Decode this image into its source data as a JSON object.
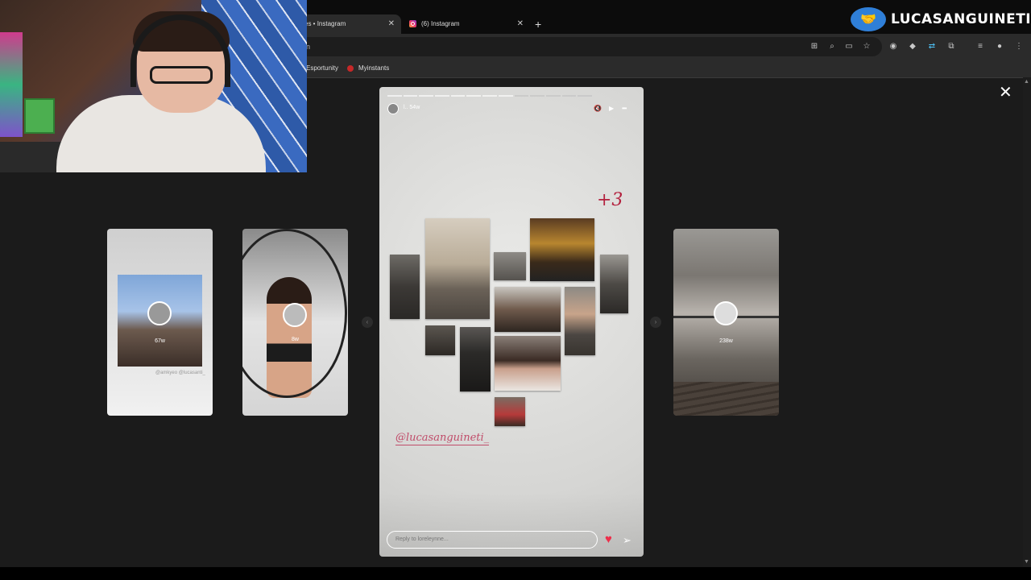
{
  "browser": {
    "tabs": [
      {
        "title": "es • Instagram",
        "active": true
      },
      {
        "title": "(6) Instagram",
        "active": false
      }
    ],
    "new_tab_label": "+",
    "close_tab_glyph": "✕",
    "address_text": "n",
    "bookmarks": [
      {
        "label": "Esportunity"
      },
      {
        "label": "Myinstants"
      }
    ]
  },
  "overlay": {
    "channel_name": "LUCASANGUINETIMP",
    "logo_icon": "handshake-icon"
  },
  "viewer": {
    "close_glyph": "✕",
    "prev_glyph": "‹",
    "next_glyph": "›",
    "left_stories": [
      {
        "timestamp": "67w",
        "caption": "@amkyeo @lucasanti_"
      },
      {
        "timestamp": "8w",
        "caption": ""
      }
    ],
    "right_stories": [
      {
        "timestamp": "238w"
      }
    ],
    "story": {
      "username": "l..",
      "timestamp": "54w",
      "sticker_text": "+3",
      "mention": "@lucasanguineti_",
      "reply_placeholder": "Reply to loreleynne...",
      "mute_glyph": "🔇",
      "play_glyph": "▶",
      "more_glyph": "•••",
      "heart_glyph": "♥",
      "send_glyph": "➢",
      "progress_segments": 13,
      "progress_completed": 8,
      "colors": {
        "sticker": "#b3203d",
        "heart": "#ed2f4b",
        "mention": "#c04c6a"
      }
    }
  }
}
